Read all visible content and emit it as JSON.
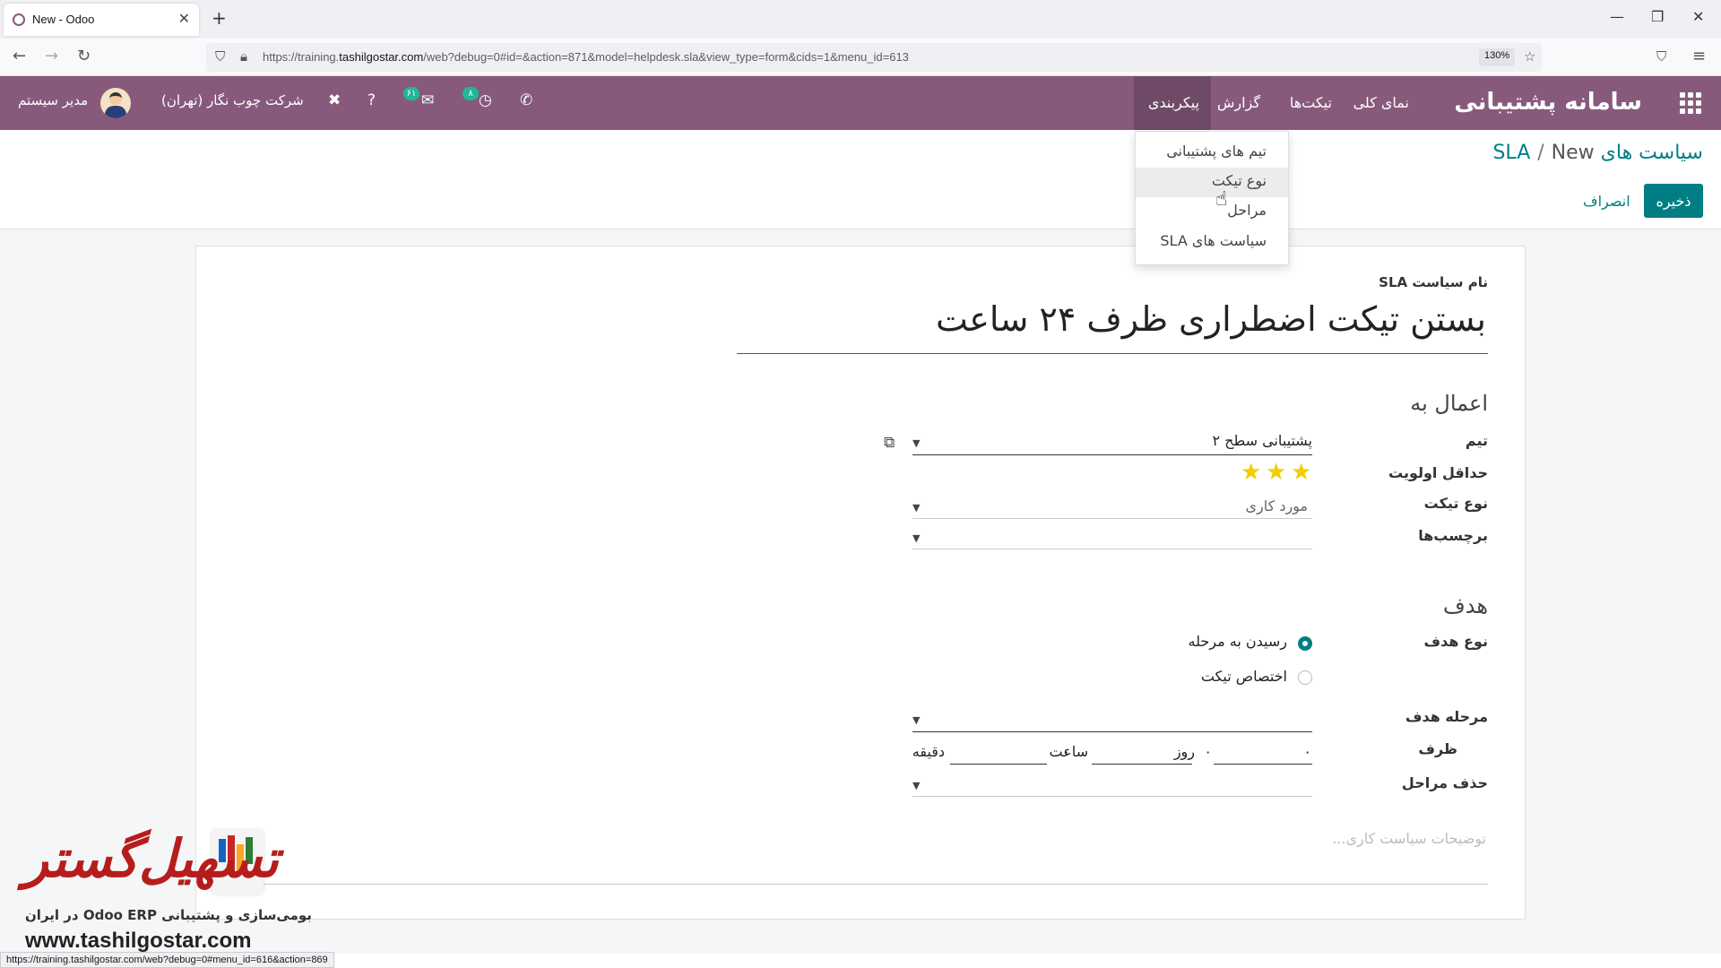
{
  "browser": {
    "tab_title": "New - Odoo",
    "url_prefix": "https://training.",
    "url_host": "tashilgostar.com",
    "url_path": "/web?debug=0#id=&action=871&model=helpdesk.sla&view_type=form&cids=1&menu_id=613",
    "zoom": "130%",
    "status_url": "https://training.tashilgostar.com/web?debug=0#menu_id=616&action=869"
  },
  "navbar": {
    "brand": "سامانه پشتیبانی",
    "menu": [
      "نمای کلی",
      "تیکت‌ها",
      "گزارش",
      "پیکربندی"
    ],
    "company": "شرکت چوب نگار (تهران)",
    "user": "مدیر سیستم",
    "badge_messages": "۶۱",
    "badge_activities": "۸"
  },
  "dropdown": {
    "items": [
      "تیم های پشتیبانی",
      "نوع تیکت",
      "مراحل",
      "سیاست های SLA"
    ]
  },
  "breadcrumb": {
    "parent": "سیاست های SLA",
    "current": "New"
  },
  "actions": {
    "save": "ذخیره",
    "discard": "انصراف"
  },
  "form": {
    "name_label": "نام سیاست SLA",
    "name_value": "بستن تیکت اضطراری ظرف ۲۴ ساعت",
    "section_apply": "اعمال به",
    "team_label": "تیم",
    "team_value": "پشتیبانی سطح ۲",
    "priority_label": "حداقل اولویت",
    "priority_stars": 3,
    "ticket_type_label": "نوع تیکت",
    "ticket_type_value": "مورد کاری",
    "tags_label": "برچسب‌ها",
    "section_target": "هدف",
    "target_type_label": "نوع هدف",
    "target_options": [
      "رسیدن به مرحله",
      "اختصاص تیکت"
    ],
    "target_selected": 0,
    "target_stage_label": "مرحله هدف",
    "within_label": "ظرف",
    "days_value": "۰",
    "days_unit": "روز",
    "hours_value": "۰",
    "hours_unit": "ساعت",
    "minutes_unit": "دقیقه",
    "excluded_stages_label": "حذف مراحل",
    "description_placeholder": "توضیحات سیاست کاری..."
  },
  "watermark": {
    "logo_text": "تسهیل‌گستر",
    "subtitle": "بومی‌سازی و پشتیبانی Odoo ERP در ایران",
    "url": "www.tashilgostar.com"
  },
  "colors": {
    "primary": "#875A7B",
    "accent": "#017e84",
    "star": "#f3cc00"
  }
}
